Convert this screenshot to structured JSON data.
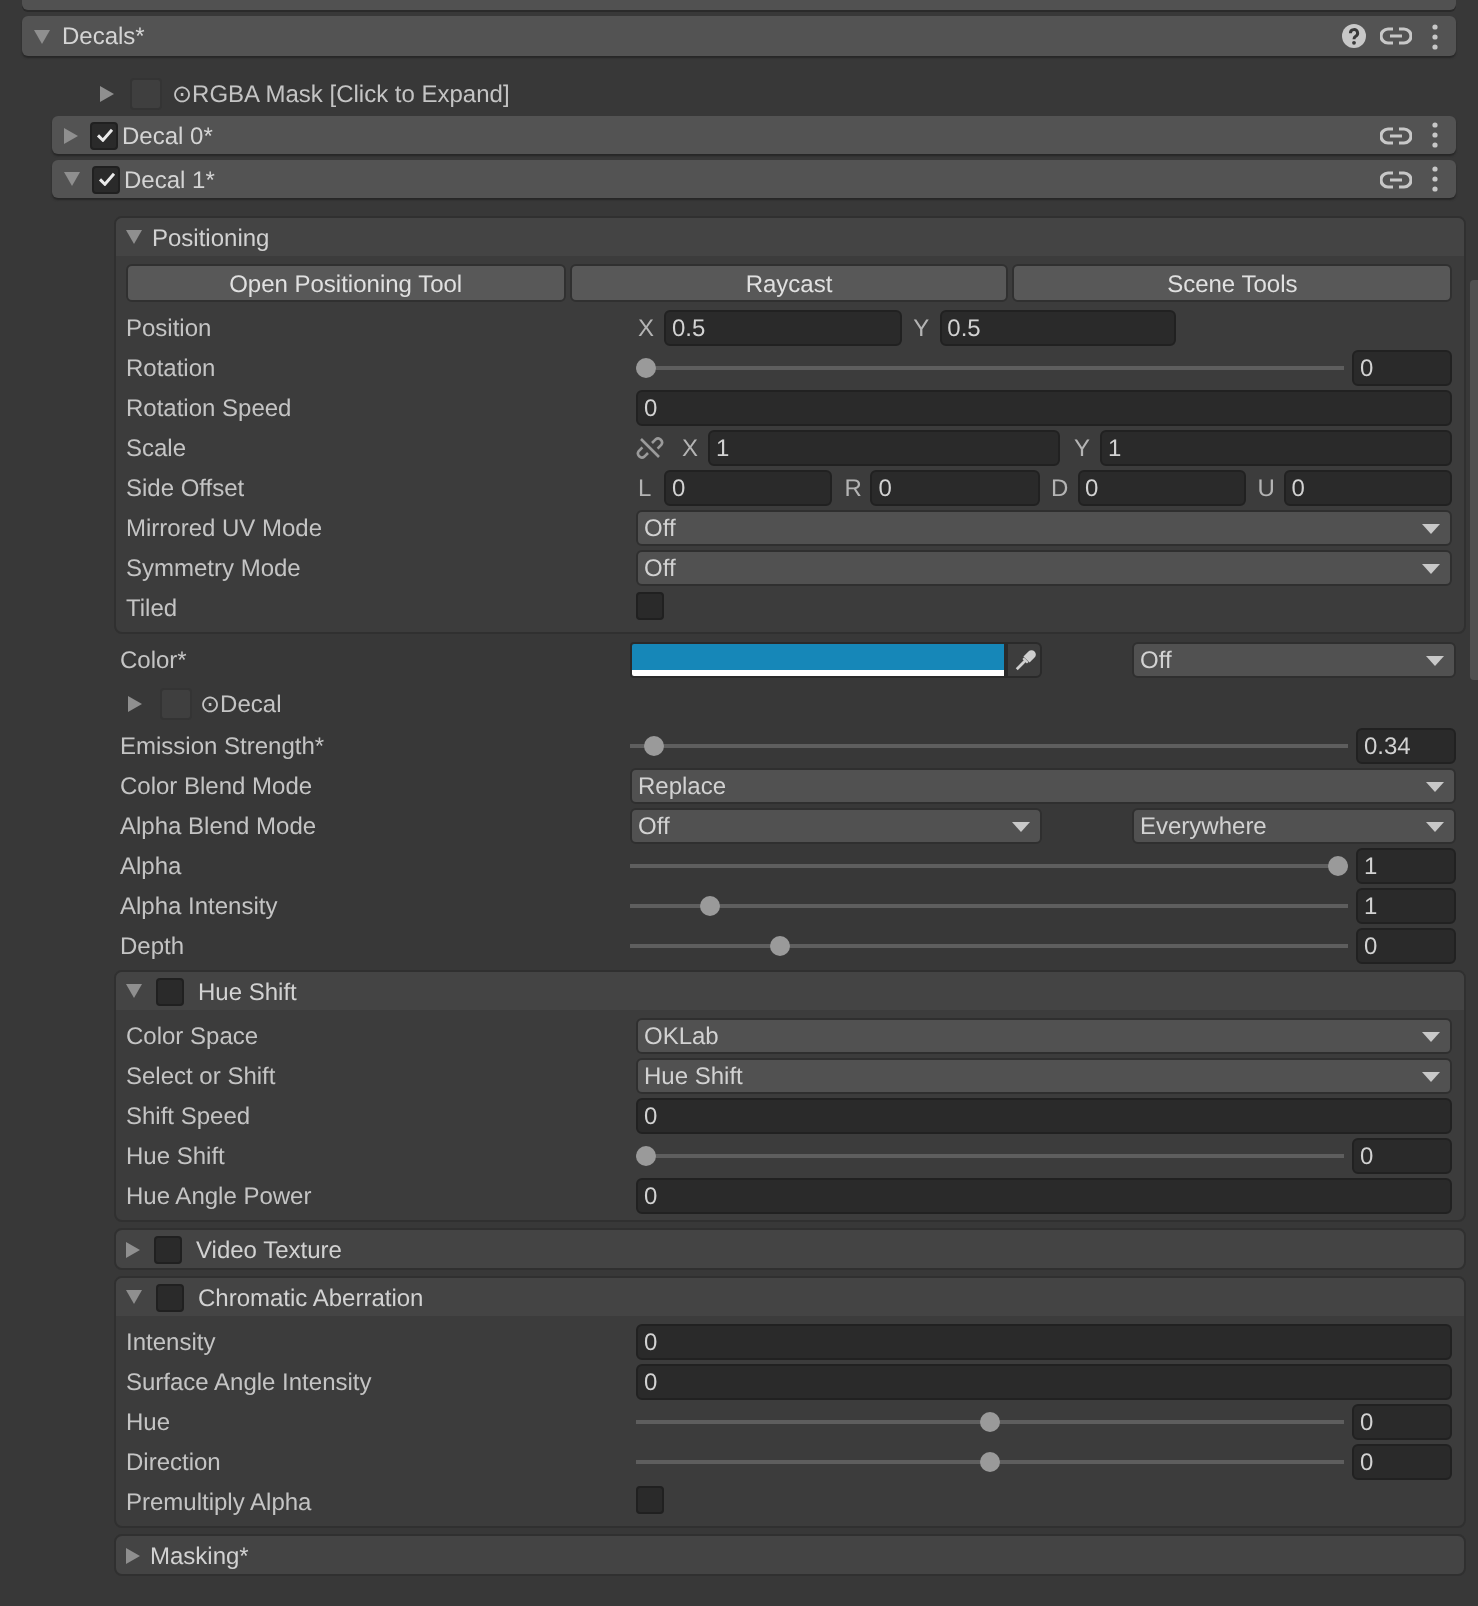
{
  "decals_header": {
    "title": "Decals*",
    "expanded": true
  },
  "rgba_mask": {
    "label": "⊙RGBA Mask [Click to Expand]",
    "expanded": false
  },
  "decals": [
    {
      "title": "Decal 0*",
      "checked": true,
      "expanded": false
    },
    {
      "title": "Decal 1*",
      "checked": true,
      "expanded": true,
      "content": [
        {
          "kind": "section",
          "title": "Positioning",
          "expanded": true,
          "buttons": [
            "Open Positioning Tool",
            "Raycast",
            "Scene Tools"
          ],
          "rows": [
            {
              "kind": "vector2",
              "label": "Position",
              "components": [
                {
                  "axis": "X",
                  "value": "0.5"
                },
                {
                  "axis": "Y",
                  "value": "0.5"
                }
              ]
            },
            {
              "kind": "slider",
              "label": "Rotation",
              "level": 0,
              "value": "0"
            },
            {
              "kind": "number",
              "label": "Rotation Speed",
              "value": "0"
            },
            {
              "kind": "scale",
              "label": "Scale",
              "constrained": false,
              "components": [
                {
                  "axis": "X",
                  "value": "1"
                },
                {
                  "axis": "Y",
                  "value": "1"
                }
              ]
            },
            {
              "kind": "vector4",
              "label": "Side Offset",
              "components": [
                {
                  "axis": "L",
                  "value": "0"
                },
                {
                  "axis": "R",
                  "value": "0"
                },
                {
                  "axis": "D",
                  "value": "0"
                },
                {
                  "axis": "U",
                  "value": "0"
                }
              ]
            },
            {
              "kind": "dropdown",
              "label": "Mirrored UV Mode",
              "value": "Off"
            },
            {
              "kind": "dropdown",
              "label": "Symmetry Mode",
              "value": "Off"
            },
            {
              "kind": "checkbox",
              "label": "Tiled",
              "checked": false
            }
          ]
        },
        {
          "kind": "color",
          "label": "Color*",
          "color": "#1687b8",
          "dropdown": "Off"
        },
        {
          "kind": "foldout",
          "label": "⊙Decal",
          "expanded": false
        },
        {
          "kind": "slider",
          "label": "Emission Strength*",
          "level": 0.02,
          "value": "0.34"
        },
        {
          "kind": "dropdown",
          "label": "Color Blend Mode",
          "value": "Replace"
        },
        {
          "kind": "dual_dropdown",
          "label": "Alpha Blend Mode",
          "values": [
            "Off",
            "Everywhere"
          ]
        },
        {
          "kind": "slider",
          "label": "Alpha",
          "level": 1,
          "value": "1"
        },
        {
          "kind": "slider",
          "label": "Alpha Intensity",
          "level": 0.1,
          "value": "1"
        },
        {
          "kind": "slider",
          "label": "Depth",
          "level": 0.2,
          "value": "0"
        },
        {
          "kind": "toggle_section",
          "title": "Hue Shift",
          "checked": false,
          "expanded": true,
          "rows": [
            {
              "kind": "dropdown",
              "label": "Color Space",
              "value": "OKLab"
            },
            {
              "kind": "dropdown",
              "label": "Select or Shift",
              "value": "Hue Shift"
            },
            {
              "kind": "number",
              "label": "Shift Speed",
              "value": "0"
            },
            {
              "kind": "slider",
              "label": "Hue Shift",
              "level": 0,
              "value": "0"
            },
            {
              "kind": "number",
              "label": "Hue Angle Power",
              "value": "0"
            }
          ]
        },
        {
          "kind": "toggle_section",
          "title": "Video Texture",
          "checked": false,
          "expanded": false
        },
        {
          "kind": "toggle_section",
          "title": "Chromatic Aberration",
          "checked": false,
          "expanded": true,
          "rows": [
            {
              "kind": "number",
              "label": "Intensity",
              "value": "0"
            },
            {
              "kind": "number",
              "label": "Surface Angle Intensity",
              "value": "0"
            },
            {
              "kind": "slider",
              "label": "Hue",
              "level": 0.5,
              "value": "0"
            },
            {
              "kind": "slider",
              "label": "Direction",
              "level": 0.5,
              "value": "0"
            },
            {
              "kind": "checkbox",
              "label": "Premultiply Alpha",
              "checked": false
            }
          ]
        },
        {
          "kind": "section",
          "title": "Masking*",
          "expanded": false
        }
      ]
    }
  ]
}
